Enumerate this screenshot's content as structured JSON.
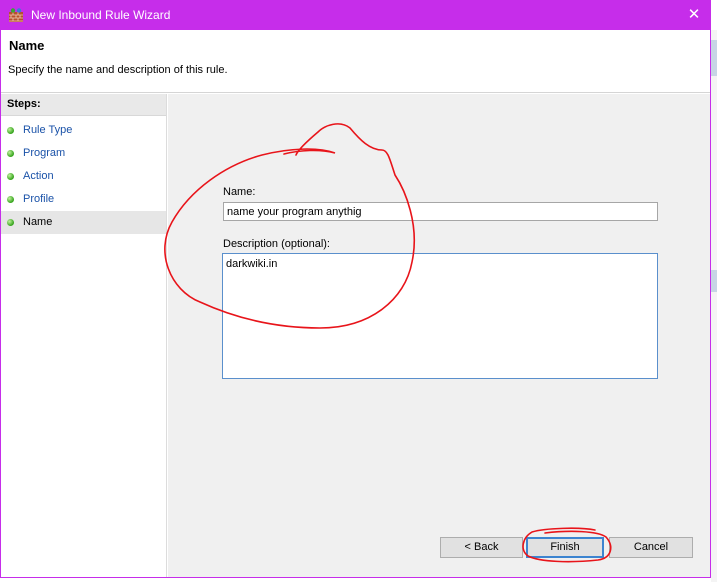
{
  "window": {
    "title": "New Inbound Rule Wizard",
    "icon": "firewall-app-icon",
    "close_glyph": "✕",
    "accent_color": "#c62dea"
  },
  "header": {
    "title": "Name",
    "description": "Specify the name and description of this rule."
  },
  "steps": {
    "heading": "Steps:",
    "items": [
      {
        "label": "Rule Type"
      },
      {
        "label": "Program"
      },
      {
        "label": "Action"
      },
      {
        "label": "Profile"
      },
      {
        "label": "Name",
        "active": true
      }
    ]
  },
  "form": {
    "name_label": "Name:",
    "name_value": "name your program anythig",
    "description_label": "Description (optional):",
    "description_value": "darkwiki.in"
  },
  "buttons": {
    "back": "< Back",
    "finish": "Finish",
    "cancel": "Cancel"
  },
  "annotations": {
    "color": "#e8141a"
  }
}
